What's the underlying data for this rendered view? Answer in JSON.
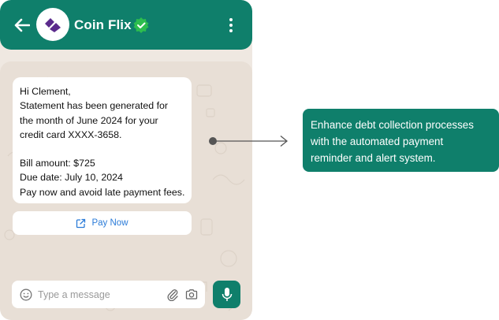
{
  "header": {
    "title": "Coin Flix",
    "back_icon": "arrow-left-icon",
    "verified_icon": "verified-badge-icon",
    "menu_icon": "more-vertical-icon"
  },
  "message": {
    "lines_top": [
      "Hi Clement,",
      "Statement has been generated for",
      "the month of June 2024 for your",
      "credit card XXXX-3658."
    ],
    "lines_bottom": [
      "Bill amount: $725",
      "Due date: July 10, 2024",
      "Pay now and avoid late payment fees."
    ]
  },
  "action": {
    "label": "Pay Now",
    "icon": "external-link-icon"
  },
  "composer": {
    "placeholder": "Type a message",
    "emoji_icon": "emoji-icon",
    "attach_icon": "paperclip-icon",
    "camera_icon": "camera-icon",
    "mic_icon": "microphone-icon"
  },
  "callout": {
    "lines": [
      "Enhance debt collection processes",
      "with the automated payment",
      "reminder and alert system."
    ]
  },
  "colors": {
    "brand": "#0f7f6b",
    "chat_bg": "#e8dfd6",
    "link": "#2a7bd8",
    "logo": "#5b2a8c"
  }
}
